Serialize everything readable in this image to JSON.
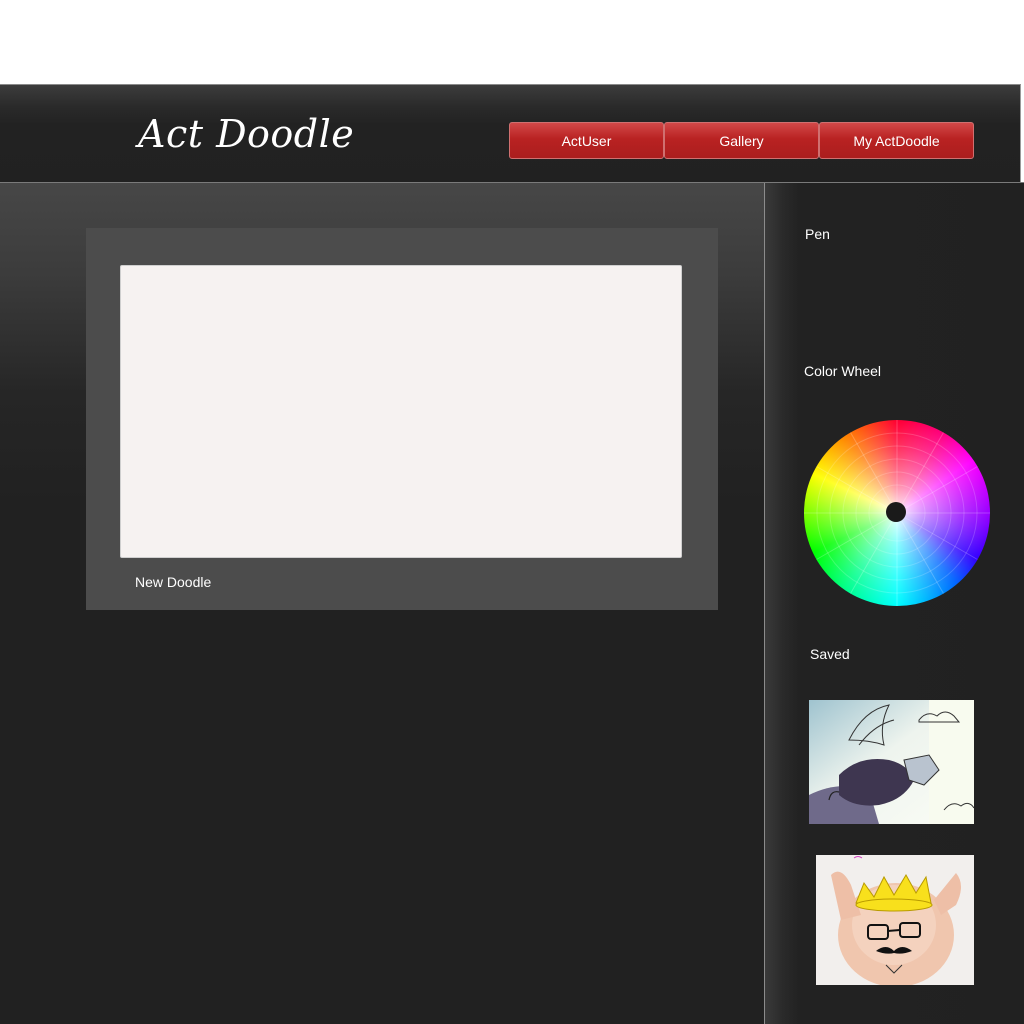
{
  "app": {
    "title": "Act Doodle"
  },
  "nav": {
    "items": [
      {
        "label": "ActUser"
      },
      {
        "label": "Gallery"
      },
      {
        "label": "My ActDoodle"
      }
    ],
    "accent_color": "#b92222"
  },
  "canvas": {
    "label": "New Doodle",
    "background_color": "#f6f2f1"
  },
  "sidebar": {
    "pen_label": "Pen",
    "color_wheel_label": "Color Wheel",
    "saved_label": "Saved",
    "saved_items": [
      {
        "icon": "cat-with-wings-doodle-image"
      },
      {
        "icon": "baby-with-crown-doodle-image"
      }
    ]
  }
}
